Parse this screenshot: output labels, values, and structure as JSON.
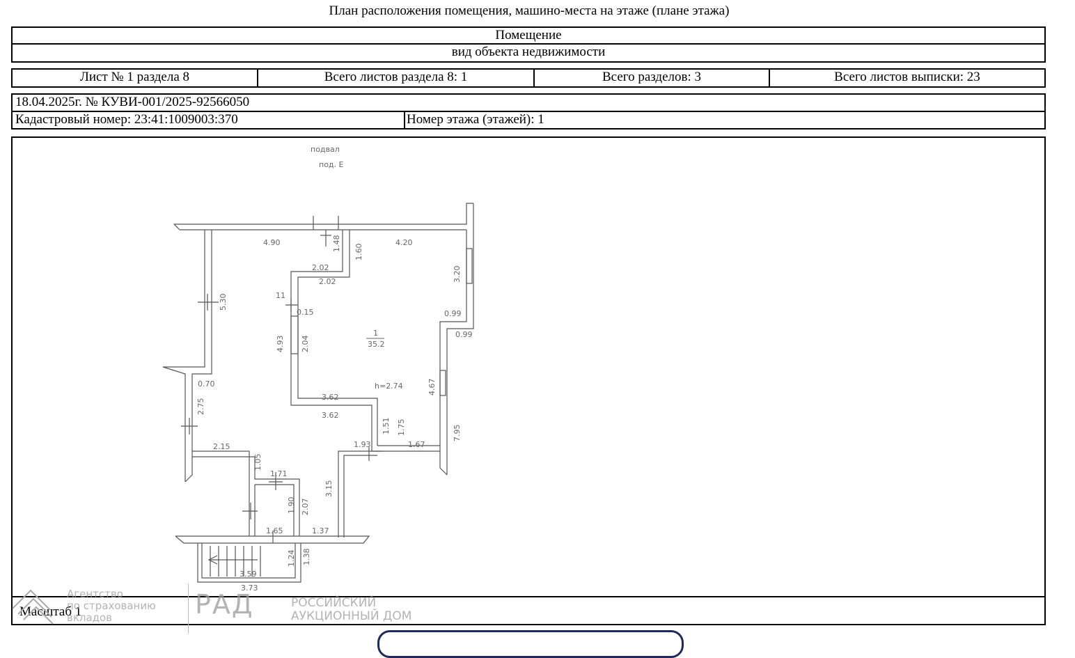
{
  "header": {
    "title": "План расположения помещения, машино-места на этаже (плане этажа)"
  },
  "object": {
    "type": "Помещение",
    "caption": "вид объекта недвижимости"
  },
  "sheet_info": {
    "sheet": "Лист № 1 раздела 8",
    "section_sheets": "Всего листов раздела 8: 1",
    "sections": "Всего разделов: 3",
    "extract_sheets": "Всего листов выписки: 23"
  },
  "record": {
    "date_number": "18.04.2025г. № КУВИ-001/2025-92566050",
    "cadastral": "Кадастровый номер: 23:41:1009003:370",
    "floor": "Номер этажа (этажей): 1"
  },
  "plan": {
    "labels": {
      "basement": "подвал",
      "entrance": "под. Е",
      "room_number": "1",
      "room_area": "35.2",
      "height": "h=2.74",
      "aux_11": "11"
    },
    "dimensions": {
      "d490": "4.90",
      "d148": "1.48",
      "d160": "1.60",
      "d420": "4.20",
      "d202a": "2.02",
      "d202b": "2.02",
      "d320": "3.20",
      "d530": "5.30",
      "d015": "0.15",
      "d099a": "0.99",
      "d099b": "0.99",
      "d493": "4.93",
      "d204": "2.04",
      "d070": "0.70",
      "d275": "2.75",
      "d467": "4.67",
      "d362a": "3.62",
      "d362b": "3.62",
      "d151": "1.51",
      "d175": "1.75",
      "d795": "7.95",
      "d215": "2.15",
      "d193": "1.93",
      "d167": "1.67",
      "d105": "1.05",
      "d171": "1.71",
      "d190": "1.90",
      "d207": "2.07",
      "d315": "3.15",
      "d165": "1.65",
      "d137": "1.37",
      "d124": "1.24",
      "d138": "1.38",
      "d359": "3.59",
      "d373": "3.73"
    }
  },
  "footer": {
    "scale": "Масштаб 1"
  },
  "watermarks": {
    "agency_line1": "Агентство",
    "agency_line2": "по страхованию",
    "agency_line3": "вкладов",
    "rad_logo": "РАД",
    "rad_line1": "РОССИЙСКИЙ",
    "rad_line2": "АУКЦИОННЫЙ ДОМ"
  }
}
